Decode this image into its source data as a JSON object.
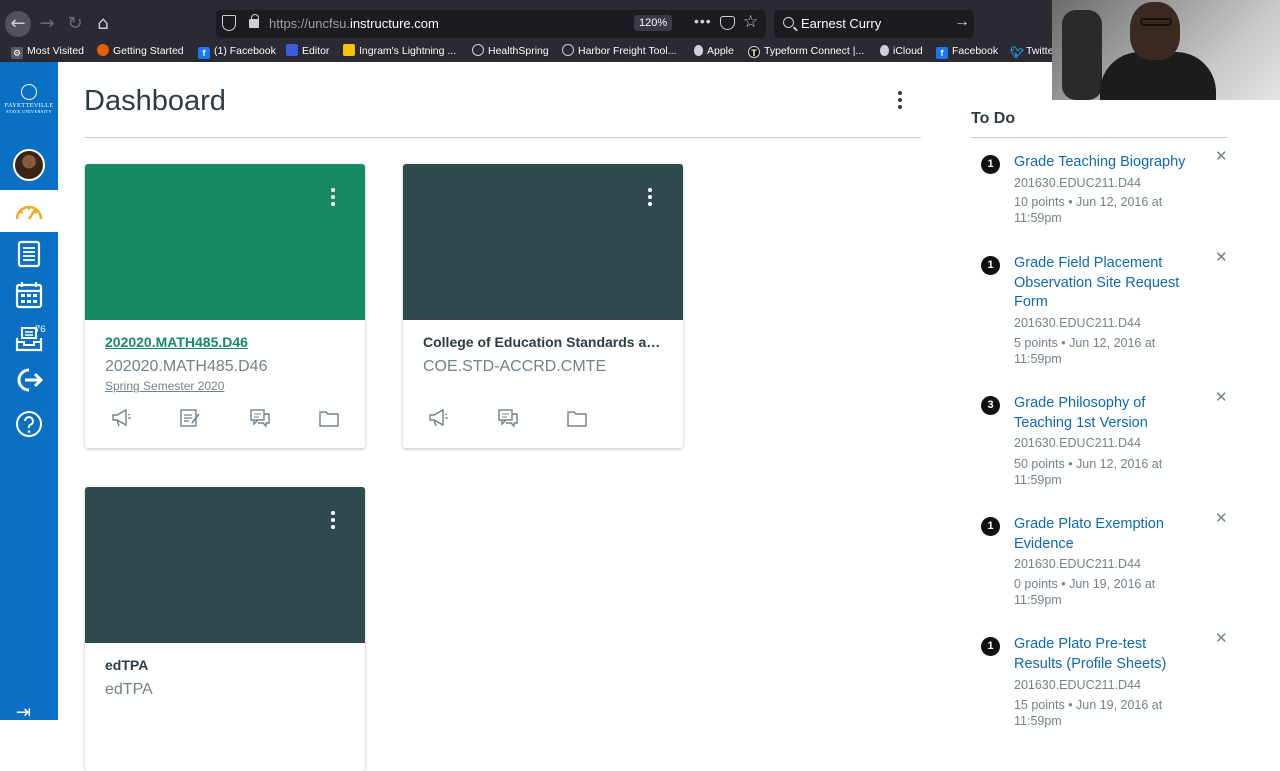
{
  "browser": {
    "url_prefix": "https://uncfsu.",
    "url_domain": "instructure.com",
    "zoom": "120%",
    "search_text": "Earnest Curry"
  },
  "bookmarks": [
    {
      "label": "Most Visited",
      "icon": "gear-icon",
      "color": "#5b5b66"
    },
    {
      "label": "Getting Started",
      "icon": "firefox-icon",
      "color": "#e66000"
    },
    {
      "label": "(1) Facebook",
      "icon": "facebook-icon",
      "color": "#1877f2"
    },
    {
      "label": "Editor",
      "icon": "editor-icon",
      "color": "#3b5bdb"
    },
    {
      "label": "Ingram's Lightning ...",
      "icon": "lightning-icon",
      "color": "#f5c400"
    },
    {
      "label": "HealthSpring",
      "icon": "globe-icon",
      "color": "#5b5b66"
    },
    {
      "label": "Harbor Freight Tool...",
      "icon": "globe-icon",
      "color": "#5b5b66"
    },
    {
      "label": "Apple",
      "icon": "apple-icon",
      "color": "#5b5b66"
    },
    {
      "label": "Typeform Connect |...",
      "icon": "typeform-icon",
      "color": "#111111"
    },
    {
      "label": "iCloud",
      "icon": "apple-icon",
      "color": "#5b5b66"
    },
    {
      "label": "Facebook",
      "icon": "facebook-icon",
      "color": "#1877f2"
    },
    {
      "label": "Twitte",
      "icon": "twitter-icon",
      "color": "#1da1f2"
    }
  ],
  "global_nav": {
    "logo_line1": "FAYETTEVILLE",
    "logo_line2": "STATE UNIVERSITY",
    "inbox_count": "76",
    "accent": "#0a70c3",
    "active_icon_color": "#f5a623"
  },
  "dashboard": {
    "title": "Dashboard",
    "cards": [
      {
        "title": "202020.MATH485.D46",
        "code": "202020.MATH485.D46",
        "term": "Spring Semester 2020",
        "hero_color": "#178a63",
        "title_color": "#178a63",
        "underline": true
      },
      {
        "title": "College of Education Standards an...",
        "code": "COE.STD-ACCRD.CMTE",
        "term": "",
        "hero_color": "#2e4a4f",
        "title_color": "#2d3b45",
        "underline": false
      },
      {
        "title": "edTPA",
        "code": "edTPA",
        "term": "",
        "hero_color": "#2e4a4f",
        "title_color": "#2d3b45",
        "underline": false
      }
    ]
  },
  "todo": {
    "title": "To Do",
    "items": [
      {
        "badge": "1",
        "title": "Grade Teaching Biography",
        "course": "201630.EDUC211.D44",
        "meta": "10 points • Jun 12, 2016 at 11:59pm"
      },
      {
        "badge": "1",
        "title": "Grade Field Placement Observation Site Request Form",
        "course": "201630.EDUC211.D44",
        "meta": "5 points • Jun 12, 2016 at 11:59pm"
      },
      {
        "badge": "3",
        "title": "Grade Philosophy of Teaching 1st Version",
        "course": "201630.EDUC211.D44",
        "meta": "50 points • Jun 12, 2016 at 11:59pm"
      },
      {
        "badge": "1",
        "title": "Grade Plato Exemption Evidence",
        "course": "201630.EDUC211.D44",
        "meta": "0 points • Jun 19, 2016 at 11:59pm"
      },
      {
        "badge": "1",
        "title": "Grade Plato Pre-test Results (Profile Sheets)",
        "course": "201630.EDUC211.D44",
        "meta": "15 points • Jun 19, 2016 at 11:59pm"
      }
    ]
  }
}
